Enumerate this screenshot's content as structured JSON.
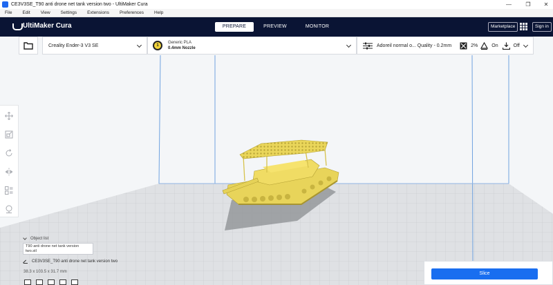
{
  "window": {
    "title": "CE3V3SE_T90 anti drone net tank version two - UltiMaker Cura",
    "controls": {
      "minimize": "—",
      "maximize": "❐",
      "close": "✕"
    }
  },
  "menu": [
    "File",
    "Edit",
    "View",
    "Settings",
    "Extensions",
    "Preferences",
    "Help"
  ],
  "header": {
    "logo": "UltiMaker Cura",
    "stages": [
      {
        "label": "PREPARE",
        "active": true
      },
      {
        "label": "PREVIEW",
        "active": false
      },
      {
        "label": "MONITOR",
        "active": false
      }
    ],
    "marketplace": "Marketplace",
    "signin": "Sign in"
  },
  "toolbar": {
    "printer": "Creality Ender-3 V3 SE",
    "material": {
      "badge": "1",
      "name": "Generic PLA",
      "nozzle": "0.4mm Nozzle"
    },
    "print": {
      "profile": "Adoreil normal o... Quality - 0.2mm",
      "infill": "2%",
      "support": "On",
      "adhesion": "Off"
    }
  },
  "object_list": {
    "toggle_label": "Object list",
    "item": "T90 anti drone net tank version two.stl",
    "job_name": "CE3V3SE_T90 anti drone net tank version two",
    "dimensions": "38.3 x 103.5 x 31.7 mm"
  },
  "slice": {
    "label": "Slice"
  },
  "colors": {
    "header_bg": "#0a1434",
    "accent": "#196ef0",
    "model": "#ecd95e",
    "build_plate": "#dfe1e4"
  },
  "icons": {
    "open": "folder-icon",
    "profile": "sliders-icon",
    "infill": "infill-icon",
    "support": "support-icon",
    "adhesion": "adhesion-icon",
    "apps": "apps-grid-icon",
    "tools": [
      "move-icon",
      "scale-icon",
      "rotate-icon",
      "mirror-icon",
      "per-model-settings-icon",
      "support-blocker-icon"
    ],
    "views": [
      "3d-view-icon",
      "front-view-icon",
      "top-view-icon",
      "left-view-icon",
      "right-view-icon"
    ]
  }
}
